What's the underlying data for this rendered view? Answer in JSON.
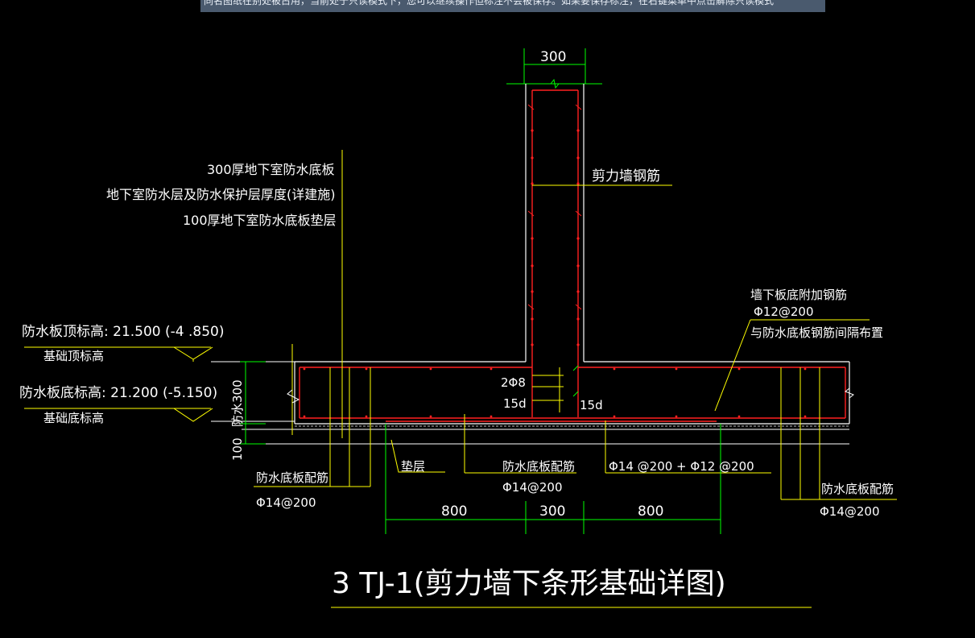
{
  "app": {
    "readonly_notice": "同名图纸在别处被占用，当前处于只读模式下，您可以继续操作但标注不会被保存。如果要保存标注，在右键菜单中点击解除只读模式"
  },
  "colors": {
    "background": "#000000",
    "green": "#00ff00",
    "yellow": "#ffff00",
    "red": "#ff2020",
    "white": "#ffffff",
    "notice_bg": "#4a5a6e"
  },
  "drawing": {
    "title": "3 TJ-1(剪力墙下条形基础详图)",
    "dimensions": {
      "wall_width_top": "300",
      "bottom_left": "800",
      "bottom_center": "300",
      "bottom_right": "800",
      "slab_thickness_vertical": "防水300",
      "cushion_thickness_vertical": "100"
    },
    "notes": {
      "layer1": "300厚地下室防水底板",
      "layer2": "地下室防水层及防水保护层厚度(详建施)",
      "layer3": "100厚地下室防水底板垫层",
      "shear_wall_rebar": "剪力墙钢筋",
      "extra_rebar_title": "墙下板底附加钢筋",
      "extra_rebar_spec": "Φ12@200",
      "extra_rebar_note": "与防水底板钢筋间隔布置",
      "top_elev": "防水板顶标高: 21.500 (-4 .850)",
      "top_elev_sub": "基础顶标高",
      "bottom_elev": "防水板底标高: 21.200 (-5.150)",
      "bottom_elev_sub": "基础底标高",
      "stirrup": "2Φ8",
      "anchor_left": "15d",
      "anchor_right": "15d",
      "slab_rebar_left": "防水底板配筋",
      "slab_rebar_left_spec": "Φ14@200",
      "cushion": "垫层",
      "slab_rebar_mid": "防水底板配筋",
      "slab_rebar_mid_spec": "Φ14@200",
      "combined_rebar": "Φ14 @200 + Φ12 @200",
      "slab_rebar_right": "防水底板配筋",
      "slab_rebar_right_spec": "Φ14@200"
    }
  }
}
